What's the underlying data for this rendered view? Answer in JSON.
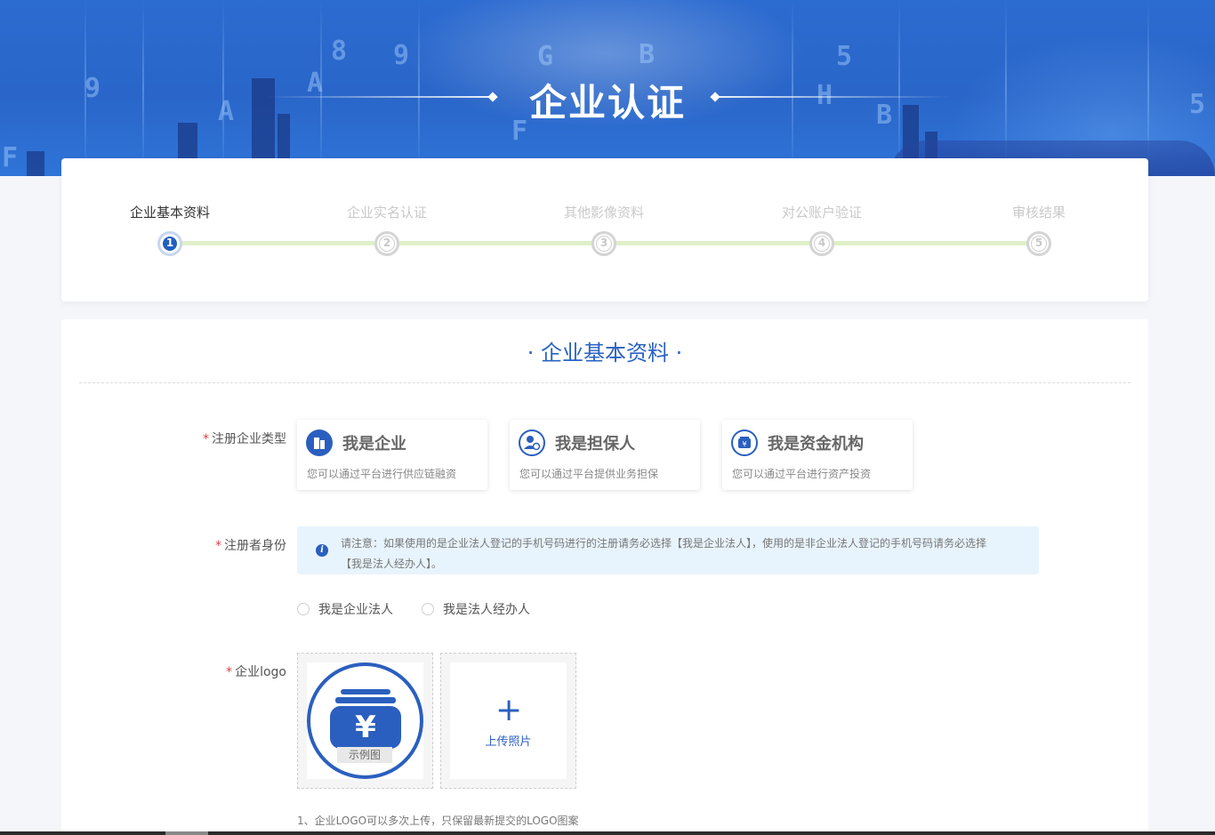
{
  "hero": {
    "title": "企业认证"
  },
  "steps": [
    {
      "num": "1",
      "label": "企业基本资料",
      "active": true
    },
    {
      "num": "2",
      "label": "企业实名认证",
      "active": false
    },
    {
      "num": "3",
      "label": "其他影像资料",
      "active": false
    },
    {
      "num": "4",
      "label": "对公账户验证",
      "active": false
    },
    {
      "num": "5",
      "label": "审核结果",
      "active": false
    }
  ],
  "form": {
    "section_title": "· 企业基本资料 ·",
    "company_type_label": "注册企业类型",
    "required_mark": "*",
    "types": [
      {
        "title": "我是企业",
        "desc": "您可以通过平台进行供应链融资",
        "icon": "building-icon"
      },
      {
        "title": "我是担保人",
        "desc": "您可以通过平台提供业务担保",
        "icon": "guarantor-icon"
      },
      {
        "title": "我是资金机构",
        "desc": "您可以通过平台进行资产投资",
        "icon": "funding-icon"
      }
    ],
    "identity_label": "注册者身份",
    "notice_line1": "请注意：如果使用的是企业法人登记的手机号码进行的注册请务必选择【我是企业法人】，使用的是非企业法人登记的手机号码请务必选择",
    "notice_line2": "【我是法人经办人】。",
    "radios": [
      {
        "label": "我是企业法人",
        "checked": false
      },
      {
        "label": "我是法人经办人",
        "checked": false
      }
    ],
    "logo_label": "企业logo",
    "sample_badge": "示例图",
    "upload_label": "上传照片",
    "note": "1、企业LOGO可以多次上传，只保留最新提交的LOGO图案"
  },
  "colors": {
    "brand": "#2b5fbf",
    "title_blue": "#2962c4",
    "required": "#e04040",
    "step_track": "#dff0c8",
    "notice_bg": "#e8f4fd"
  }
}
